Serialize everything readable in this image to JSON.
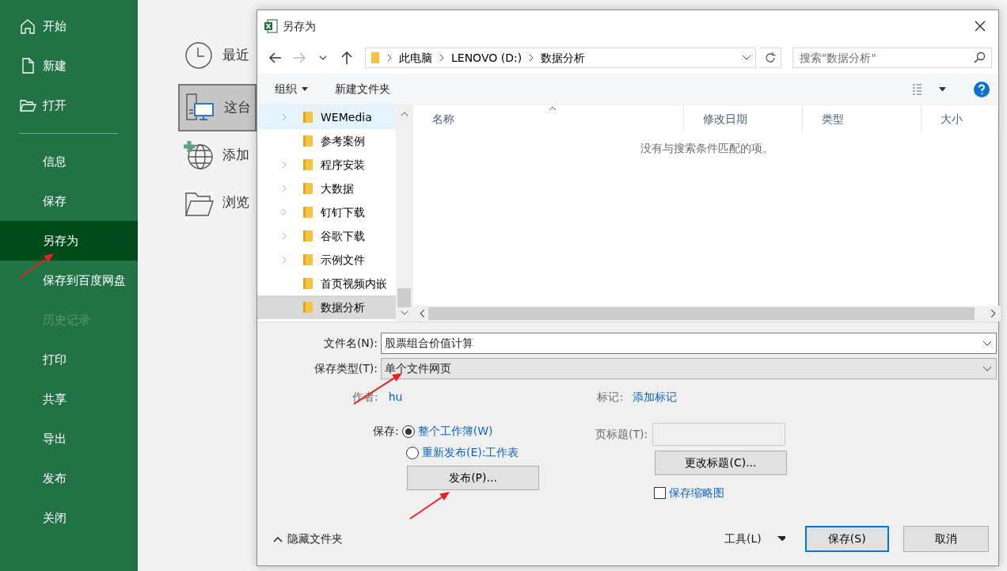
{
  "sidebar": {
    "items": [
      {
        "label": "开始",
        "selected": false,
        "disabled": false
      },
      {
        "label": "新建",
        "selected": false,
        "disabled": false
      },
      {
        "label": "打开",
        "selected": false,
        "disabled": false
      },
      {
        "label": "信息",
        "selected": false,
        "disabled": false
      },
      {
        "label": "保存",
        "selected": false,
        "disabled": false
      },
      {
        "label": "另存为",
        "selected": true,
        "disabled": false
      },
      {
        "label": "保存到百度网盘",
        "selected": false,
        "disabled": false
      },
      {
        "label": "历史记录",
        "selected": false,
        "disabled": true
      },
      {
        "label": "打印",
        "selected": false,
        "disabled": false
      },
      {
        "label": "共享",
        "selected": false,
        "disabled": false
      },
      {
        "label": "导出",
        "selected": false,
        "disabled": false
      },
      {
        "label": "发布",
        "selected": false,
        "disabled": false
      },
      {
        "label": "关闭",
        "selected": false,
        "disabled": false
      }
    ]
  },
  "places": [
    {
      "label": "最近",
      "selected": false
    },
    {
      "label": "这台",
      "selected": true
    },
    {
      "label": "添加",
      "selected": false
    },
    {
      "label": "浏览",
      "selected": false
    }
  ],
  "dialog": {
    "title": "另存为",
    "breadcrumb": [
      "此电脑",
      "LENOVO (D:)",
      "数据分析"
    ],
    "search": {
      "placeholder": "搜索\"数据分析\""
    },
    "toolbar": {
      "organize": "组织",
      "new_folder": "新建文件夹"
    },
    "tree": [
      {
        "label": "WEMedia",
        "expandable": true,
        "hovered": true,
        "selected": false
      },
      {
        "label": "参考案例",
        "expandable": false,
        "hovered": false,
        "selected": false
      },
      {
        "label": "程序安装",
        "expandable": true,
        "hovered": false,
        "selected": false
      },
      {
        "label": "大数据",
        "expandable": true,
        "hovered": false,
        "selected": false
      },
      {
        "label": "钉钉下载",
        "expandable": true,
        "hovered": false,
        "selected": false
      },
      {
        "label": "谷歌下载",
        "expandable": true,
        "hovered": false,
        "selected": false
      },
      {
        "label": "示例文件",
        "expandable": true,
        "hovered": false,
        "selected": false
      },
      {
        "label": "首页视频内嵌",
        "expandable": false,
        "hovered": false,
        "selected": false
      },
      {
        "label": "数据分析",
        "expandable": false,
        "hovered": false,
        "selected": true
      }
    ],
    "columns": [
      {
        "label": "名称",
        "sorted": true
      },
      {
        "label": "修改日期",
        "sorted": false
      },
      {
        "label": "类型",
        "sorted": false
      },
      {
        "label": "大小",
        "sorted": false
      }
    ],
    "empty_message": "没有与搜索条件匹配的项。",
    "file_name": {
      "label": "文件名(N):",
      "value": "股票组合价值计算"
    },
    "save_type": {
      "label": "保存类型(T):",
      "value": "单个文件网页"
    },
    "author": {
      "label": "作者:",
      "value": "hu"
    },
    "tags": {
      "label": "标记:",
      "value": "添加标记"
    },
    "save_scope": {
      "label": "保存:",
      "options": [
        {
          "label": "整个工作簿(W)",
          "selected": true
        },
        {
          "label": "重新发布(E):工作表",
          "selected": false
        }
      ]
    },
    "publish_button": "发布(P)...",
    "page_title": {
      "label": "页标题(T):"
    },
    "change_title_button": "更改标题(C)...",
    "thumbnail": {
      "label": "保存缩略图",
      "checked": false
    },
    "hide_folders": "隐藏文件夹",
    "tools": "工具(L)",
    "save_button": "保存(S)",
    "cancel_button": "取消"
  }
}
